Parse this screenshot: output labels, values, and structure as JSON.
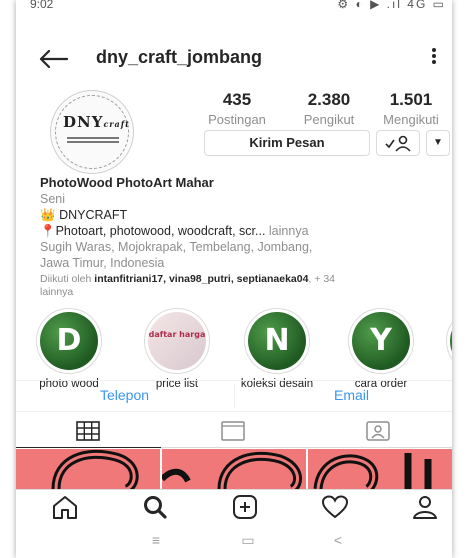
{
  "status_bar": {
    "time": "9:02",
    "right": "⚙ ◐ ▶ .ıl 4G ▭"
  },
  "header": {
    "username": "dny_craft_jombang",
    "more_icon": "vertical-dots-icon"
  },
  "avatar": {
    "logo_text": "DNY",
    "logo_suffix": "craft"
  },
  "stats": [
    {
      "value": "435",
      "label": "Postingan"
    },
    {
      "value": "2.380",
      "label": "Pengikut"
    },
    {
      "value": "1.501",
      "label": "Mengikuti"
    }
  ],
  "actions": {
    "message": "Kirim Pesan"
  },
  "bio": {
    "name": "PhotoWood PhotoArt Mahar",
    "category": "Seni",
    "line1_emoji": "👑",
    "line1": "DNYCRAFT",
    "line2_emoji": "📍",
    "line2": "Photoart, photowood, woodcraft, scr...",
    "line2_more": "lainnya",
    "line3": "Sugih Waras, Mojokrapak, Tembelang, Jombang,",
    "line4": "Jawa Timur, Indonesia",
    "followed_prefix": "Diikuti oleh",
    "followed_users": "intanfitriani17, vina98_putri, septianaeka04",
    "followed_suffix": "+ 34",
    "followed_suffix2": "lainnya"
  },
  "highlights": [
    {
      "letter": "D",
      "label": "photo wood"
    },
    {
      "letter": "",
      "label": "price list",
      "pic_text": "daftar harga"
    },
    {
      "letter": "N",
      "label": "koleksi desain"
    },
    {
      "letter": "Y",
      "label": "cara order"
    },
    {
      "letter": "",
      "label": ""
    }
  ],
  "contact": {
    "phone": "Telepon",
    "email": "Email"
  },
  "tabs": [
    "grid-icon",
    "feed-icon",
    "tagged-icon"
  ],
  "bottom_nav": [
    "home-icon",
    "search-icon",
    "add-icon",
    "heart-icon",
    "profile-icon"
  ],
  "android_nav": {
    "menu": "≡",
    "home": "▭",
    "back": "<"
  },
  "colors": {
    "link": "#3897f0",
    "post_bg": "#f07878",
    "highlight_green": "#2e6b2c"
  }
}
